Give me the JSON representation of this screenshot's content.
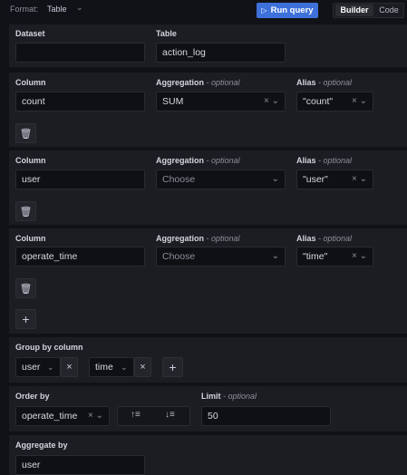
{
  "toolbar": {
    "format_label": "Format:",
    "format_value": "Table",
    "run_label": "Run query",
    "builder_label": "Builder",
    "code_label": "Code"
  },
  "dataset": {
    "label": "Dataset",
    "value": ""
  },
  "table": {
    "label": "Table",
    "value": "action_log"
  },
  "columns": [
    {
      "column_label": "Column",
      "column_value": "count",
      "agg_label": "Aggregation",
      "agg_optional": " - optional",
      "agg_value": "SUM",
      "agg_is_placeholder": false,
      "alias_label": "Alias",
      "alias_optional": " - optional",
      "alias_value": "\"count\""
    },
    {
      "column_label": "Column",
      "column_value": "user",
      "agg_label": "Aggregation",
      "agg_optional": " - optional",
      "agg_value": "Choose",
      "agg_is_placeholder": true,
      "alias_label": "Alias",
      "alias_optional": " - optional",
      "alias_value": "\"user\""
    },
    {
      "column_label": "Column",
      "column_value": "operate_time",
      "agg_label": "Aggregation",
      "agg_optional": " - optional",
      "agg_value": "Choose",
      "agg_is_placeholder": true,
      "alias_label": "Alias",
      "alias_optional": " - optional",
      "alias_value": "\"time\""
    }
  ],
  "group_by": {
    "label": "Group by column",
    "items": [
      "user",
      "time"
    ]
  },
  "order_by": {
    "label": "Order by",
    "value": "operate_time"
  },
  "limit": {
    "label": "Limit",
    "optional": " - optional",
    "value": "50"
  },
  "aggregate_by": {
    "label": "Aggregate by",
    "value": "user"
  },
  "icons": {
    "chevron": "chevron-down-icon",
    "clear": "close-icon",
    "trash": "trash-icon",
    "add": "plus-icon",
    "play": "play-icon",
    "sort_asc": "sort-ascending-icon",
    "sort_desc": "sort-descending-icon"
  },
  "colors": {
    "accent": "#3d71d9",
    "background": "#111217",
    "panel": "#1c1d22"
  }
}
